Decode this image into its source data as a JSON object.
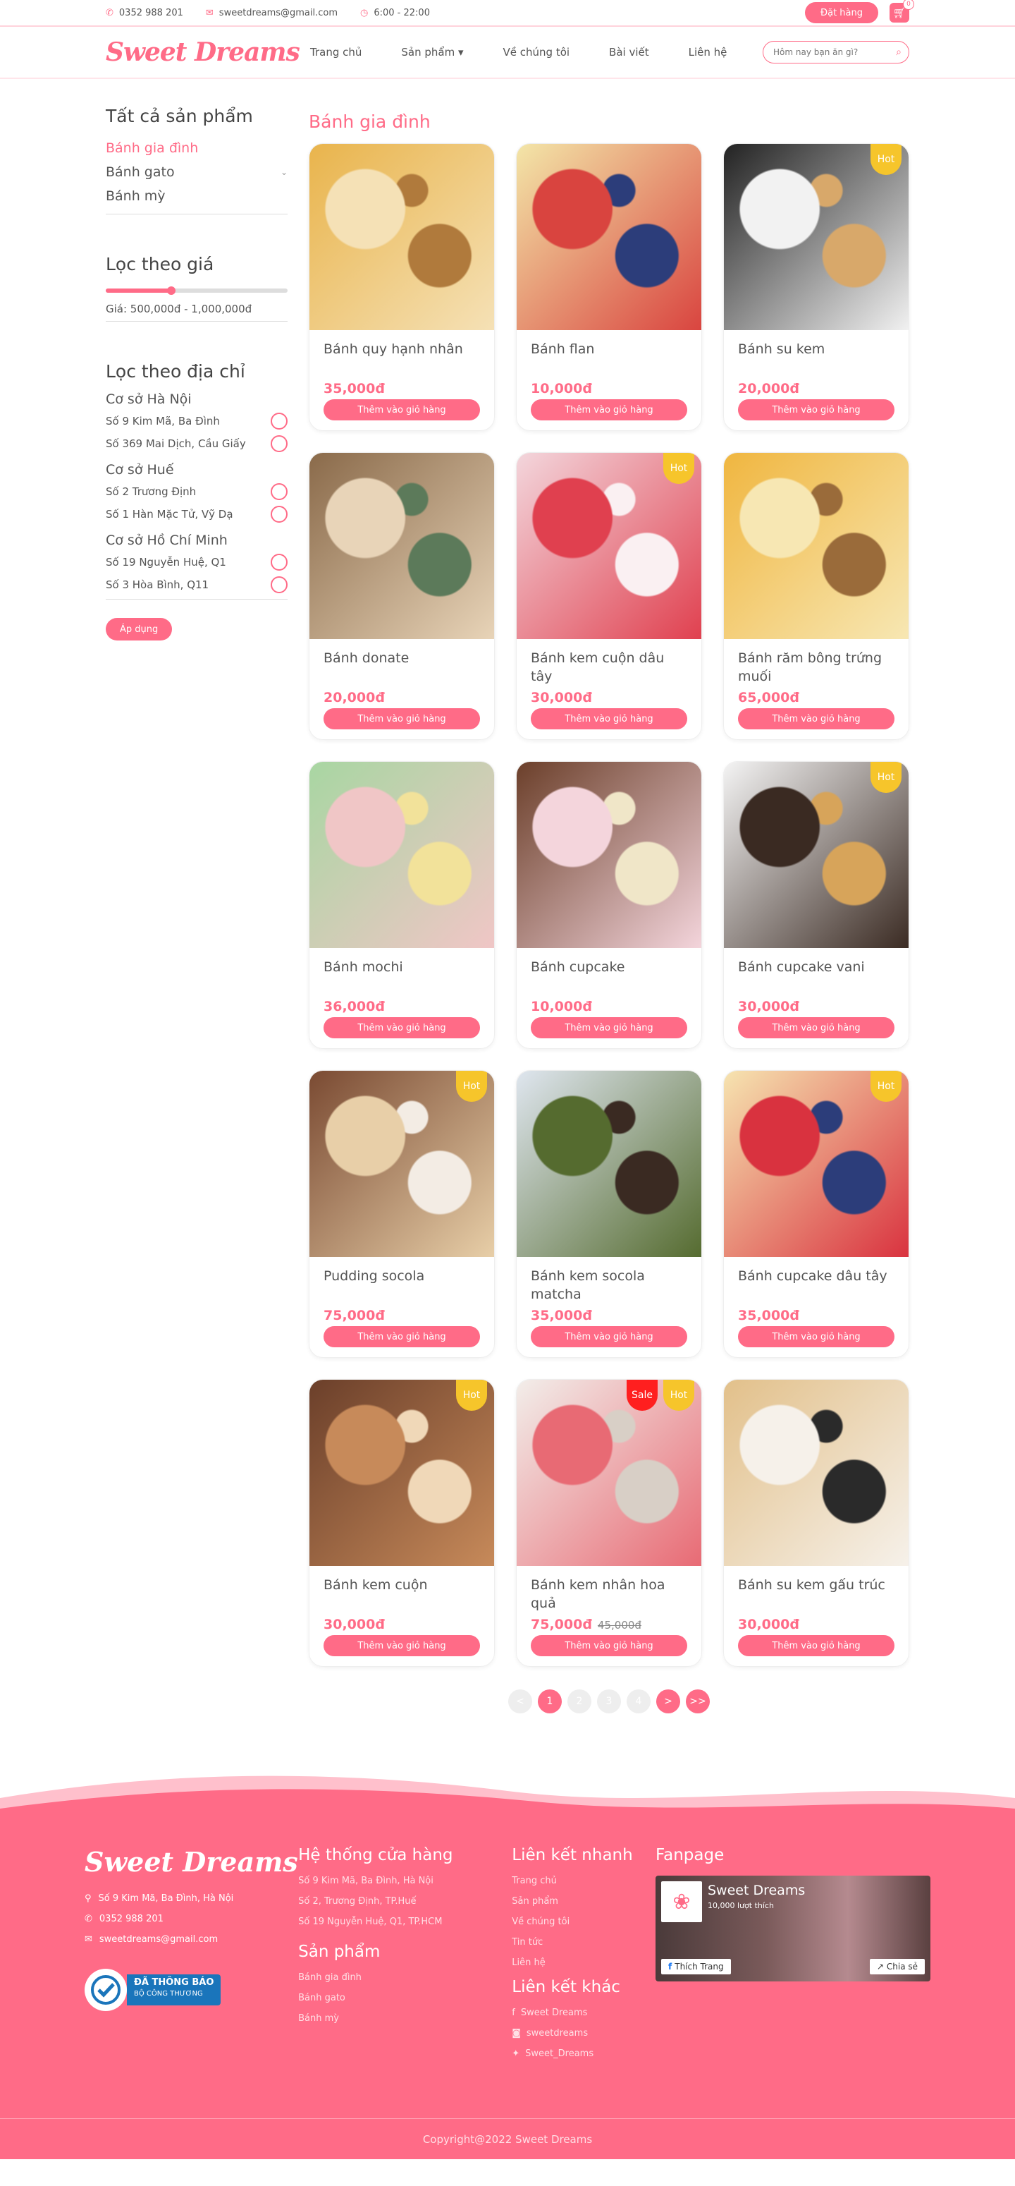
{
  "topbar": {
    "phone": "0352 988 201",
    "email": "sweetdreams@gmail.com",
    "hours": "6:00 - 22:00",
    "order_button": "Đặt hàng",
    "cart_count": "0"
  },
  "nav": {
    "logo": "Sweet Dreams",
    "menu": [
      "Trang chủ",
      "Sản phẩm ▾",
      "Về chúng tôi",
      "Bài viết",
      "Liên hệ"
    ],
    "search_placeholder": "Hôm nay bạn ăn gì?"
  },
  "sidebar": {
    "all_products": "Tất cả sản phẩm",
    "categories": [
      "Bánh gia đình",
      "Bánh gato",
      "Bánh mỳ"
    ],
    "price_title": "Lọc theo giá",
    "price_range": "Giá: 500,000đ - 1,000,000đ",
    "price_fill": 0.36,
    "location_title": "Lọc theo địa chỉ",
    "branches": [
      {
        "name": "Cơ sở Hà Nội",
        "addresses": [
          "Số 9 Kim Mã, Ba Đình",
          "Số 369 Mai Dịch, Cầu Giấy"
        ]
      },
      {
        "name": "Cơ sở Huế",
        "addresses": [
          "Số 2 Trương Định",
          "Số 1 Hàn Mặc Tử, Vỹ Dạ"
        ]
      },
      {
        "name": "Cơ sở Hồ Chí Minh",
        "addresses": [
          "Số 19 Nguyễn Huệ, Q1",
          "Số 3 Hòa Bình, Q11"
        ]
      }
    ],
    "apply_button": "Áp dụng"
  },
  "content": {
    "title": "Bánh gia đình",
    "add_to_cart": "Thêm vào giỏ hàng",
    "products": [
      {
        "name": "Bánh quy hạnh nhân",
        "price": "35,000đ",
        "hot": false,
        "sale": false,
        "old_price": "",
        "colors": [
          "#e9b44c",
          "#f5e1b6",
          "#b07a3c"
        ]
      },
      {
        "name": "Bánh flan",
        "price": "10,000đ",
        "hot": false,
        "sale": false,
        "old_price": "",
        "colors": [
          "#f3e6a8",
          "#d9443f",
          "#2c3d7a"
        ]
      },
      {
        "name": "Bánh su kem",
        "price": "20,000đ",
        "hot": true,
        "sale": false,
        "old_price": "",
        "colors": [
          "#222222",
          "#f2f2f2",
          "#d8a86a"
        ]
      },
      {
        "name": "Bánh donate",
        "price": "20,000đ",
        "hot": false,
        "sale": false,
        "old_price": "",
        "colors": [
          "#8a6a4a",
          "#e8d4b8",
          "#5c7a5a"
        ]
      },
      {
        "name": "Bánh kem cuộn dâu tây",
        "price": "30,000đ",
        "hot": true,
        "sale": false,
        "old_price": "",
        "colors": [
          "#f3d6dc",
          "#e0404f",
          "#faf0f2"
        ]
      },
      {
        "name": "Bánh răm bông trứng muối",
        "price": "65,000đ",
        "hot": false,
        "sale": false,
        "old_price": "",
        "colors": [
          "#f0b640",
          "#f7e7b3",
          "#9a6b3a"
        ]
      },
      {
        "name": "Bánh mochi",
        "price": "36,000đ",
        "hot": false,
        "sale": false,
        "old_price": "",
        "colors": [
          "#a8d6a2",
          "#f0c6c6",
          "#f2e29a"
        ]
      },
      {
        "name": "Bánh cupcake",
        "price": "10,000đ",
        "hot": false,
        "sale": false,
        "old_price": "",
        "colors": [
          "#6b3f2a",
          "#f4d5dc",
          "#f0e6c8"
        ]
      },
      {
        "name": "Bánh cupcake vani",
        "price": "30,000đ",
        "hot": true,
        "sale": false,
        "old_price": "",
        "colors": [
          "#f4f4f4",
          "#3a2a22",
          "#d7a45a"
        ]
      },
      {
        "name": "Pudding socola",
        "price": "75,000đ",
        "hot": true,
        "sale": false,
        "old_price": "",
        "colors": [
          "#7a4a32",
          "#e8cfa8",
          "#f3ece4"
        ]
      },
      {
        "name": "Bánh kem socola matcha",
        "price": "35,000đ",
        "hot": false,
        "sale": false,
        "old_price": "",
        "colors": [
          "#dfe6ef",
          "#556b2f",
          "#3a2a22"
        ]
      },
      {
        "name": "Bánh cupcake dâu tây",
        "price": "35,000đ",
        "hot": true,
        "sale": false,
        "old_price": "",
        "colors": [
          "#f6e4b0",
          "#d9323f",
          "#2c3d7a"
        ]
      },
      {
        "name": "Bánh kem cuộn",
        "price": "30,000đ",
        "hot": true,
        "sale": false,
        "old_price": "",
        "colors": [
          "#6b3f2a",
          "#c78a5a",
          "#f0d8b8"
        ]
      },
      {
        "name": "Bánh kem nhân hoa quả",
        "price": "75,000đ",
        "hot": true,
        "sale": true,
        "old_price": "45,000đ",
        "colors": [
          "#f2eeea",
          "#e86a74",
          "#d8cfc6"
        ]
      },
      {
        "name": "Bánh su kem gấu trúc",
        "price": "30,000đ",
        "hot": false,
        "sale": false,
        "old_price": "",
        "colors": [
          "#e2c08a",
          "#f6f1ea",
          "#2a2a2a"
        ]
      }
    ],
    "hot_label": "Hot",
    "sale_label": "Sale"
  },
  "pagination": [
    "<",
    "1",
    "2",
    "3",
    "4",
    ">",
    ">>"
  ],
  "pagination_active": [
    "1",
    ">",
    ">>"
  ],
  "footer": {
    "logo": "Sweet Dreams",
    "address": "Số 9 Kim Mã, Ba Đình, Hà Nội",
    "phone": "0352 988 201",
    "email": "sweetdreams@gmail.com",
    "bct_line1": "ĐÃ THÔNG BÁO",
    "bct_line2": "BỘ CÔNG THƯƠNG",
    "stores_title": "Hệ thống cửa hàng",
    "stores": [
      "Số 9 Kim Mã, Ba Đình, Hà Nội",
      "Số 2, Trương Định, TP.Huế",
      "Số 19 Nguyễn Huệ, Q1, TP.HCM"
    ],
    "products_title": "Sản phẩm",
    "products": [
      "Bánh gia đình",
      "Bánh gato",
      "Bánh mỳ"
    ],
    "quick_title": "Liên kết nhanh",
    "quick": [
      "Trang chủ",
      "Sản phẩm",
      "Về chúng tôi",
      "Tin tức",
      "Liên hệ"
    ],
    "other_title": "Liên kết khác",
    "other": [
      "Sweet Dreams",
      "sweetdreams",
      "Sweet_Dreams"
    ],
    "fanpage_title": "Fanpage",
    "fb_name": "Sweet Dreams",
    "fb_likes": "10,000 lượt thích",
    "fb_like_btn": "Thích Trang",
    "fb_share_btn": "Chia sẻ",
    "copyright": "Copyright@2022 Sweet Dreams"
  }
}
